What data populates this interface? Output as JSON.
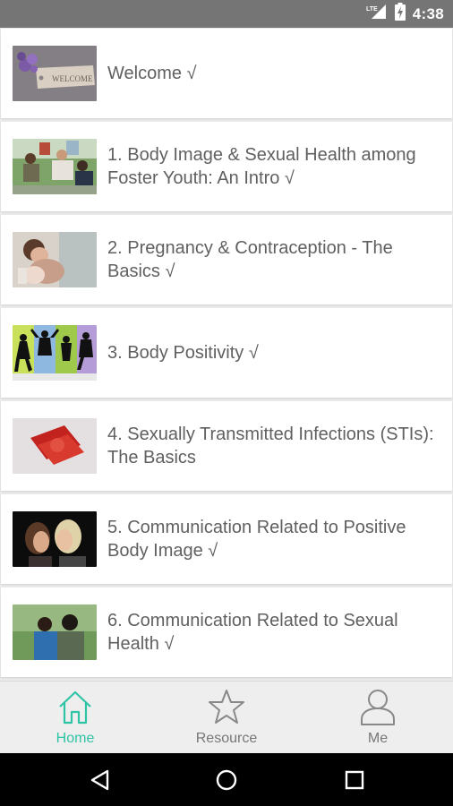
{
  "status_bar": {
    "time": "4:38",
    "network": "LTE",
    "icons": [
      "lte-signal-icon",
      "battery-charging-icon"
    ]
  },
  "lessons": [
    {
      "title": "Welcome √",
      "thumb": "welcome-tag-flowers-photo"
    },
    {
      "title": "1. Body Image & Sexual Health among Foster Youth: An Intro √",
      "thumb": "youth-group-photo"
    },
    {
      "title": "2. Pregnancy & Contraception - The Basics √",
      "thumb": "mother-baby-photo"
    },
    {
      "title": "3. Body Positivity √",
      "thumb": "jumping-silhouettes-photo"
    },
    {
      "title": "4. Sexually Transmitted Infections (STIs): The Basics",
      "thumb": "condom-packets-photo"
    },
    {
      "title": "5. Communication Related to Positive Body Image √",
      "thumb": "two-women-talking-photo"
    },
    {
      "title": "6. Communication Related to Sexual Health √",
      "thumb": "two-people-talking-photo"
    }
  ],
  "bottom_nav": {
    "active": "home",
    "home_label": "Home",
    "resource_label": "Resource",
    "me_label": "Me"
  },
  "colors": {
    "accent": "#2ec4a6",
    "status_bar": "#757575",
    "text": "#606060"
  }
}
